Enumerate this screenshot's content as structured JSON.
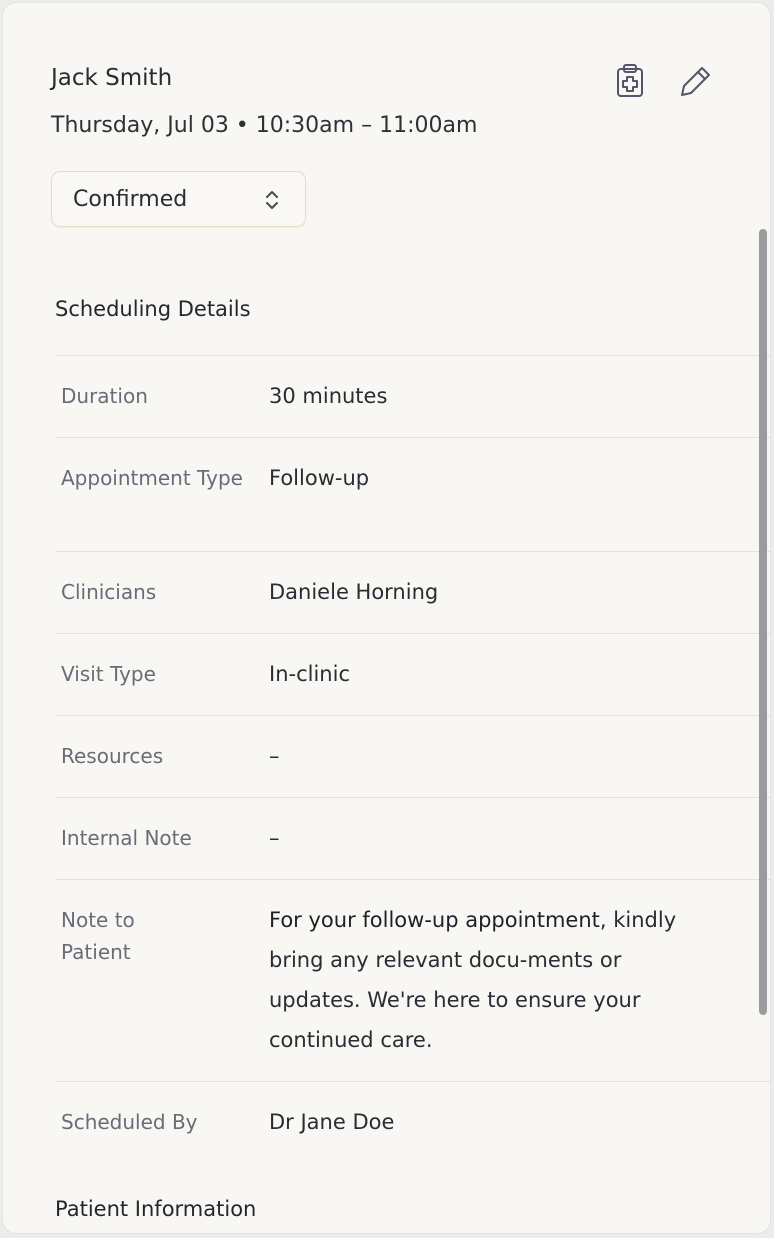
{
  "header": {
    "patient_name": "Jack Smith",
    "datetime": "Thursday, Jul 03 • 10:30am – 11:00am",
    "status": "Confirmed"
  },
  "sections": {
    "scheduling_title": "Scheduling Details",
    "patient_title": "Patient Information"
  },
  "details": [
    {
      "label": "Duration",
      "value": "30 minutes"
    },
    {
      "label": "Appointment Type",
      "value": "Follow-up"
    },
    {
      "label": "Clinicians",
      "value": "Daniele Horning"
    },
    {
      "label": "Visit Type",
      "value": "In-clinic"
    },
    {
      "label": "Resources",
      "value": "–"
    },
    {
      "label": "Internal Note",
      "value": "–"
    },
    {
      "label": "Note to Patient",
      "value_bold": "For your follow-up appointment",
      "value": ", kindly bring any relevant docu-ments or updates. We're here to ensure your continued care."
    },
    {
      "label": "Scheduled By",
      "value": "Dr Jane Doe"
    }
  ],
  "icons": {
    "clipboard": "clipboard-plus-icon",
    "edit": "pencil-icon",
    "status_chevron": "chevron-up-down-icon"
  }
}
